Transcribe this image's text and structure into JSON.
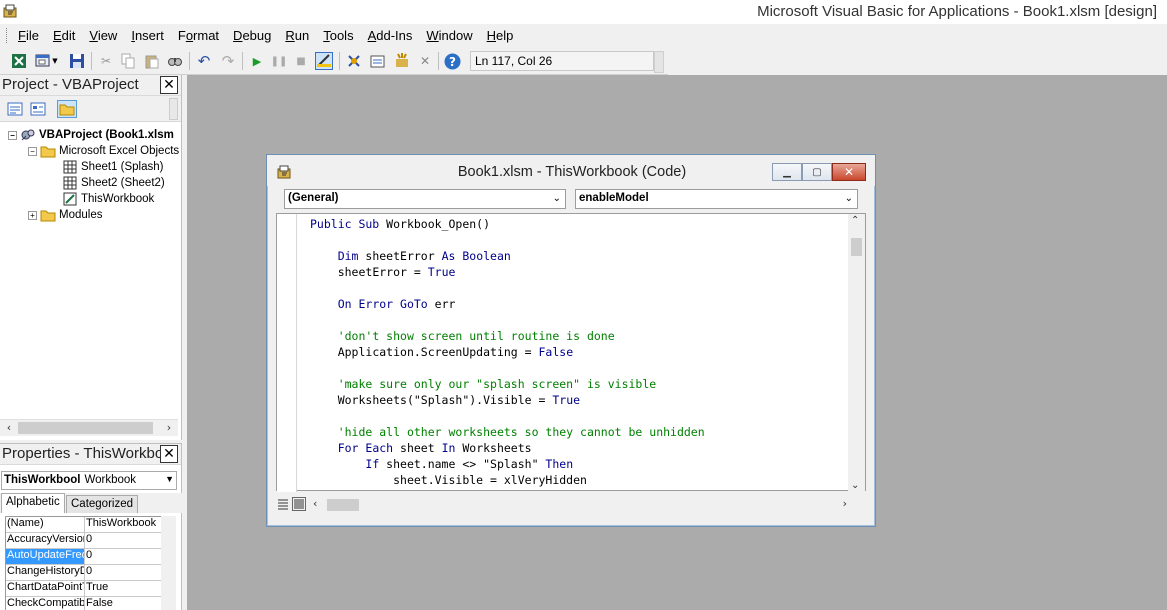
{
  "window": {
    "title": "Microsoft Visual Basic for Applications - Book1.xlsm [design]"
  },
  "menu": {
    "items": [
      "File",
      "Edit",
      "View",
      "Insert",
      "Format",
      "Debug",
      "Run",
      "Tools",
      "Add-Ins",
      "Window",
      "Help"
    ],
    "accesskeys": [
      "F",
      "E",
      "V",
      "I",
      "o",
      "D",
      "R",
      "T",
      "A",
      "W",
      "H"
    ]
  },
  "toolbar": {
    "buttons": [
      "view-excel-icon",
      "insert-module-icon",
      "save-icon",
      "cut-icon",
      "copy-icon",
      "paste-icon",
      "find-icon",
      "undo-icon",
      "redo-icon",
      "run-icon",
      "break-icon",
      "reset-icon",
      "design-mode-icon",
      "project-explorer-icon",
      "properties-window-icon",
      "object-browser-icon",
      "toolbox-icon",
      "help-icon"
    ],
    "status": "Ln 117, Col 26"
  },
  "project": {
    "title": "Project - VBAProject",
    "close": "✕",
    "tree": [
      {
        "label": "VBAProject (Book1.xlsm",
        "level": 0,
        "expander": "−",
        "icon": "vba-project-icon",
        "bold": true
      },
      {
        "label": "Microsoft Excel Objects",
        "level": 1,
        "expander": "−",
        "icon": "folder-open-icon"
      },
      {
        "label": "Sheet1 (Splash)",
        "level": 2,
        "icon": "sheet-icon"
      },
      {
        "label": "Sheet2 (Sheet2)",
        "level": 2,
        "icon": "sheet-icon"
      },
      {
        "label": "ThisWorkbook",
        "level": 2,
        "icon": "workbook-icon"
      },
      {
        "label": "Modules",
        "level": 1,
        "expander": "+",
        "icon": "folder-icon"
      }
    ]
  },
  "properties": {
    "title": "Properties - ThisWorkbo",
    "close": "✕",
    "object_name": "ThisWorkbool",
    "object_type": "Workbook",
    "tabs": [
      "Alphabetic",
      "Categorized"
    ],
    "rows": [
      {
        "name": "(Name)",
        "value": "ThisWorkbook"
      },
      {
        "name": "AccuracyVersion",
        "value": "0"
      },
      {
        "name": "AutoUpdateFrequency",
        "value": "0",
        "selected": true
      },
      {
        "name": "ChangeHistoryDuration",
        "value": "0"
      },
      {
        "name": "ChartDataPointTrack",
        "value": "True"
      },
      {
        "name": "CheckCompatibility",
        "value": "False"
      }
    ]
  },
  "code_window": {
    "title": "Book1.xlsm - ThisWorkbook (Code)",
    "object_combo": "(General)",
    "proc_combo": "enableModel",
    "lines": [
      {
        "indent": 0,
        "parts": [
          {
            "t": "kw",
            "v": "Public Sub "
          },
          {
            "t": "tx",
            "v": "Workbook_Open()"
          }
        ]
      },
      {
        "indent": 0,
        "parts": []
      },
      {
        "indent": 1,
        "parts": [
          {
            "t": "kw",
            "v": "Dim "
          },
          {
            "t": "tx",
            "v": "sheetError "
          },
          {
            "t": "kw",
            "v": "As Boolean"
          }
        ]
      },
      {
        "indent": 1,
        "parts": [
          {
            "t": "tx",
            "v": "sheetError = "
          },
          {
            "t": "kw",
            "v": "True"
          }
        ]
      },
      {
        "indent": 0,
        "parts": []
      },
      {
        "indent": 1,
        "parts": [
          {
            "t": "kw",
            "v": "On Error GoTo "
          },
          {
            "t": "tx",
            "v": "err"
          }
        ]
      },
      {
        "indent": 0,
        "parts": []
      },
      {
        "indent": 1,
        "parts": [
          {
            "t": "cm",
            "v": "'don't show screen until routine is done"
          }
        ]
      },
      {
        "indent": 1,
        "parts": [
          {
            "t": "tx",
            "v": "Application.ScreenUpdating = "
          },
          {
            "t": "kw",
            "v": "False"
          }
        ]
      },
      {
        "indent": 0,
        "parts": []
      },
      {
        "indent": 1,
        "parts": [
          {
            "t": "cm",
            "v": "'make sure only our \"splash screen\" is visible"
          }
        ]
      },
      {
        "indent": 1,
        "parts": [
          {
            "t": "tx",
            "v": "Worksheets(\"Splash\").Visible = "
          },
          {
            "t": "kw",
            "v": "True"
          }
        ]
      },
      {
        "indent": 0,
        "parts": []
      },
      {
        "indent": 1,
        "parts": [
          {
            "t": "cm",
            "v": "'hide all other worksheets so they cannot be unhidden"
          }
        ]
      },
      {
        "indent": 1,
        "parts": [
          {
            "t": "kw",
            "v": "For Each "
          },
          {
            "t": "tx",
            "v": "sheet "
          },
          {
            "t": "kw",
            "v": "In "
          },
          {
            "t": "tx",
            "v": "Worksheets"
          }
        ]
      },
      {
        "indent": 2,
        "parts": [
          {
            "t": "kw",
            "v": "If "
          },
          {
            "t": "tx",
            "v": "sheet.name <> \"Splash\" "
          },
          {
            "t": "kw",
            "v": "Then"
          }
        ]
      },
      {
        "indent": 3,
        "parts": [
          {
            "t": "tx",
            "v": "sheet.Visible = xlVeryHidden"
          }
        ]
      }
    ]
  }
}
